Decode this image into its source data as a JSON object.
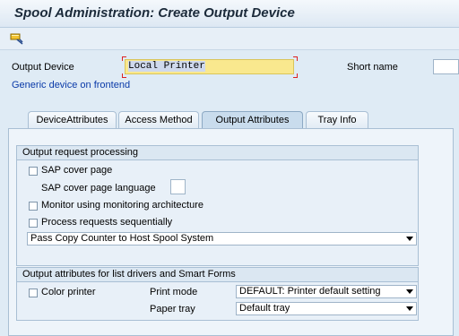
{
  "window": {
    "title": "Spool Administration: Create Output Device"
  },
  "toolbar": {
    "edit_icon": "display-change-icon"
  },
  "header": {
    "output_device_label": "Output Device",
    "output_device_value": "Local Printer",
    "short_name_label": "Short name",
    "short_name_value": "",
    "generic_link": "Generic device on frontend"
  },
  "tabs": [
    {
      "label": "DeviceAttributes",
      "active": false
    },
    {
      "label": "Access Method",
      "active": false
    },
    {
      "label": "Output Attributes",
      "active": true
    },
    {
      "label": "Tray Info",
      "active": false
    }
  ],
  "output_request": {
    "heading": "Output request processing",
    "sap_cover_page": "SAP cover page",
    "cover_page_language": "SAP cover page language",
    "cover_page_language_value": "",
    "monitor": "Monitor using monitoring architecture",
    "sequential": "Process requests sequentially",
    "copy_counter": "Pass Copy Counter to Host Spool System"
  },
  "list_drivers": {
    "heading": "Output attributes for list drivers and Smart Forms",
    "color_printer": "Color printer",
    "print_mode_label": "Print mode",
    "print_mode_value": "DEFAULT: Printer default setting",
    "paper_tray_label": "Paper tray",
    "paper_tray_value": "Default tray"
  },
  "colors": {
    "link": "#0a3aa8",
    "active_tab": "#c9dced",
    "required_input": "#f9e88e"
  }
}
